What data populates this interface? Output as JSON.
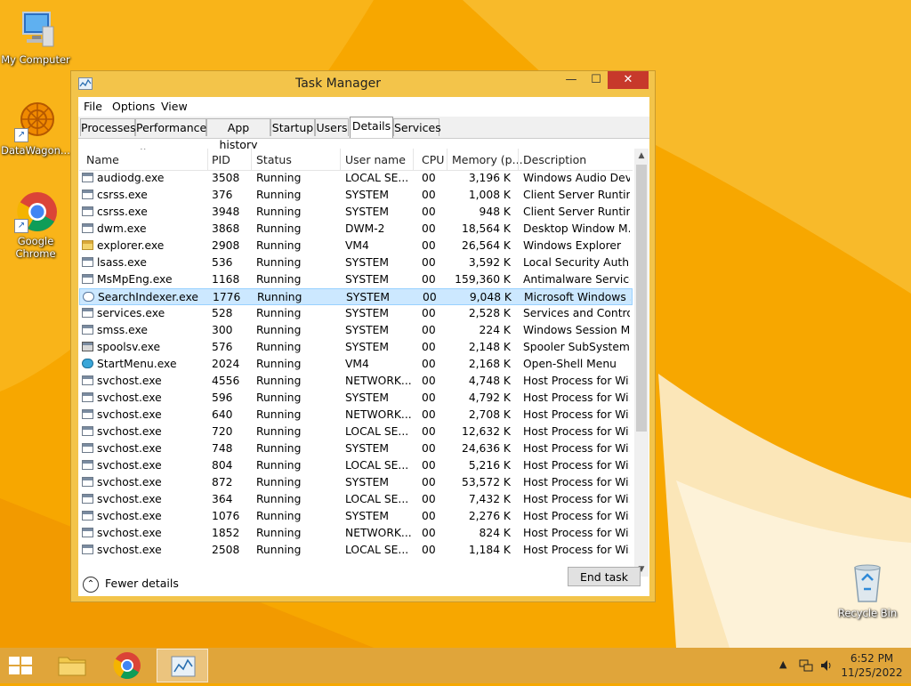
{
  "desktop": {
    "icons": [
      {
        "label": "My Computer"
      },
      {
        "label": "DataWagon..."
      },
      {
        "label": "Google Chrome"
      },
      {
        "label": "Recycle Bin"
      }
    ]
  },
  "window": {
    "title": "Task Manager",
    "controls": {
      "minimize": "—",
      "maximize": "☐",
      "close": "✕"
    },
    "menu": [
      "File",
      "Options",
      "View"
    ],
    "tabs": [
      "Processes",
      "Performance",
      "App history",
      "Startup",
      "Users",
      "Details",
      "Services"
    ],
    "active_tab": "Details",
    "columns": [
      "Name",
      "PID",
      "Status",
      "User name",
      "CPU",
      "Memory (p...",
      "Description"
    ],
    "rows": [
      {
        "name": "audiodg.exe",
        "pid": "3508",
        "status": "Running",
        "user": "LOCAL SE...",
        "cpu": "00",
        "mem": "3,196 K",
        "desc": "Windows Audio Dev...",
        "icon": "window-icon"
      },
      {
        "name": "csrss.exe",
        "pid": "376",
        "status": "Running",
        "user": "SYSTEM",
        "cpu": "00",
        "mem": "1,008 K",
        "desc": "Client Server Runtim...",
        "icon": "window-icon"
      },
      {
        "name": "csrss.exe",
        "pid": "3948",
        "status": "Running",
        "user": "SYSTEM",
        "cpu": "00",
        "mem": "948 K",
        "desc": "Client Server Runtim...",
        "icon": "window-icon"
      },
      {
        "name": "dwm.exe",
        "pid": "3868",
        "status": "Running",
        "user": "DWM-2",
        "cpu": "00",
        "mem": "18,564 K",
        "desc": "Desktop Window M...",
        "icon": "window-icon"
      },
      {
        "name": "explorer.exe",
        "pid": "2908",
        "status": "Running",
        "user": "VM4",
        "cpu": "00",
        "mem": "26,564 K",
        "desc": "Windows Explorer",
        "icon": "folder-icon"
      },
      {
        "name": "lsass.exe",
        "pid": "536",
        "status": "Running",
        "user": "SYSTEM",
        "cpu": "00",
        "mem": "3,592 K",
        "desc": "Local Security Auth...",
        "icon": "window-icon"
      },
      {
        "name": "MsMpEng.exe",
        "pid": "1168",
        "status": "Running",
        "user": "SYSTEM",
        "cpu": "00",
        "mem": "159,360 K",
        "desc": "Antimalware Service...",
        "icon": "window-icon"
      },
      {
        "name": "SearchIndexer.exe",
        "pid": "1776",
        "status": "Running",
        "user": "SYSTEM",
        "cpu": "00",
        "mem": "9,048 K",
        "desc": "Microsoft Windows ...",
        "icon": "user-icon",
        "selected": true
      },
      {
        "name": "services.exe",
        "pid": "528",
        "status": "Running",
        "user": "SYSTEM",
        "cpu": "00",
        "mem": "2,528 K",
        "desc": "Services and Control...",
        "icon": "window-icon"
      },
      {
        "name": "smss.exe",
        "pid": "300",
        "status": "Running",
        "user": "SYSTEM",
        "cpu": "00",
        "mem": "224 K",
        "desc": "Windows Session M...",
        "icon": "window-icon"
      },
      {
        "name": "spoolsv.exe",
        "pid": "576",
        "status": "Running",
        "user": "SYSTEM",
        "cpu": "00",
        "mem": "2,148 K",
        "desc": "Spooler SubSystem ...",
        "icon": "printer-icon"
      },
      {
        "name": "StartMenu.exe",
        "pid": "2024",
        "status": "Running",
        "user": "VM4",
        "cpu": "00",
        "mem": "2,168 K",
        "desc": "Open-Shell Menu",
        "icon": "globe-icon"
      },
      {
        "name": "svchost.exe",
        "pid": "4556",
        "status": "Running",
        "user": "NETWORK...",
        "cpu": "00",
        "mem": "4,748 K",
        "desc": "Host Process for Wi...",
        "icon": "window-icon"
      },
      {
        "name": "svchost.exe",
        "pid": "596",
        "status": "Running",
        "user": "SYSTEM",
        "cpu": "00",
        "mem": "4,792 K",
        "desc": "Host Process for Wi...",
        "icon": "window-icon"
      },
      {
        "name": "svchost.exe",
        "pid": "640",
        "status": "Running",
        "user": "NETWORK...",
        "cpu": "00",
        "mem": "2,708 K",
        "desc": "Host Process for Wi...",
        "icon": "window-icon"
      },
      {
        "name": "svchost.exe",
        "pid": "720",
        "status": "Running",
        "user": "LOCAL SE...",
        "cpu": "00",
        "mem": "12,632 K",
        "desc": "Host Process for Wi...",
        "icon": "window-icon"
      },
      {
        "name": "svchost.exe",
        "pid": "748",
        "status": "Running",
        "user": "SYSTEM",
        "cpu": "00",
        "mem": "24,636 K",
        "desc": "Host Process for Wi...",
        "icon": "window-icon"
      },
      {
        "name": "svchost.exe",
        "pid": "804",
        "status": "Running",
        "user": "LOCAL SE...",
        "cpu": "00",
        "mem": "5,216 K",
        "desc": "Host Process for Wi...",
        "icon": "window-icon"
      },
      {
        "name": "svchost.exe",
        "pid": "872",
        "status": "Running",
        "user": "SYSTEM",
        "cpu": "00",
        "mem": "53,572 K",
        "desc": "Host Process for Wi...",
        "icon": "window-icon"
      },
      {
        "name": "svchost.exe",
        "pid": "364",
        "status": "Running",
        "user": "LOCAL SE...",
        "cpu": "00",
        "mem": "7,432 K",
        "desc": "Host Process for Wi...",
        "icon": "window-icon"
      },
      {
        "name": "svchost.exe",
        "pid": "1076",
        "status": "Running",
        "user": "SYSTEM",
        "cpu": "00",
        "mem": "2,276 K",
        "desc": "Host Process for Wi...",
        "icon": "window-icon"
      },
      {
        "name": "svchost.exe",
        "pid": "1852",
        "status": "Running",
        "user": "NETWORK...",
        "cpu": "00",
        "mem": "824 K",
        "desc": "Host Process for Wi...",
        "icon": "window-icon"
      },
      {
        "name": "svchost.exe",
        "pid": "2508",
        "status": "Running",
        "user": "LOCAL SE...",
        "cpu": "00",
        "mem": "1,184 K",
        "desc": "Host Process for Wi...",
        "icon": "window-icon"
      }
    ],
    "footer": {
      "fewer_details": "Fewer details",
      "end_task": "End task"
    }
  },
  "taskbar": {
    "clock_time": "6:52 PM",
    "clock_date": "11/25/2022",
    "tray_icons": [
      "chevron-up-icon",
      "network-icon",
      "speaker-icon"
    ]
  },
  "colors": {
    "desktop": "#f6a800",
    "window_frame": "#f3c44a",
    "selection": "#cce8ff",
    "close": "#c7392b"
  }
}
